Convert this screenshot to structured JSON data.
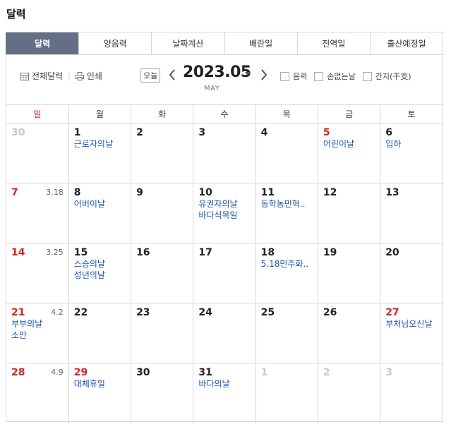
{
  "title": "달력",
  "tabs": [
    "달력",
    "양음력",
    "날짜계산",
    "배란일",
    "전역일",
    "출산예정일"
  ],
  "toolbar": {
    "full_calendar": "전체달력",
    "print": "인쇄",
    "today": "오늘",
    "year_month": "2023.05",
    "month_en": "MAY",
    "options": [
      "음력",
      "손없는날",
      "간지(干支)"
    ]
  },
  "weekdays": [
    "일",
    "월",
    "화",
    "수",
    "목",
    "금",
    "토"
  ],
  "weeks": [
    [
      {
        "d": "30",
        "type": "other",
        "lunar": "",
        "events": []
      },
      {
        "d": "1",
        "type": "normal",
        "lunar": "",
        "events": [
          "근로자의날"
        ]
      },
      {
        "d": "2",
        "type": "normal",
        "lunar": "",
        "events": []
      },
      {
        "d": "3",
        "type": "normal",
        "lunar": "",
        "events": []
      },
      {
        "d": "4",
        "type": "normal",
        "lunar": "",
        "events": []
      },
      {
        "d": "5",
        "type": "red",
        "lunar": "",
        "events": [
          "어린이날"
        ]
      },
      {
        "d": "6",
        "type": "normal",
        "lunar": "",
        "events": [
          "입하"
        ]
      }
    ],
    [
      {
        "d": "7",
        "type": "red",
        "lunar": "3.18",
        "events": []
      },
      {
        "d": "8",
        "type": "normal",
        "lunar": "",
        "events": [
          "어버이날"
        ]
      },
      {
        "d": "9",
        "type": "normal",
        "lunar": "",
        "events": []
      },
      {
        "d": "10",
        "type": "normal",
        "lunar": "",
        "events": [
          "유권자의날",
          "바다식목일"
        ]
      },
      {
        "d": "11",
        "type": "normal",
        "lunar": "",
        "events": [
          "동학농민혁.."
        ]
      },
      {
        "d": "12",
        "type": "normal",
        "lunar": "",
        "events": []
      },
      {
        "d": "13",
        "type": "normal",
        "lunar": "",
        "events": []
      }
    ],
    [
      {
        "d": "14",
        "type": "red",
        "lunar": "3.25",
        "events": []
      },
      {
        "d": "15",
        "type": "normal",
        "lunar": "",
        "events": [
          "스승의날",
          "성년의날"
        ]
      },
      {
        "d": "16",
        "type": "normal",
        "lunar": "",
        "events": []
      },
      {
        "d": "17",
        "type": "normal",
        "lunar": "",
        "events": []
      },
      {
        "d": "18",
        "type": "normal",
        "lunar": "",
        "events": [
          "5.18민주화.."
        ]
      },
      {
        "d": "19",
        "type": "normal",
        "lunar": "",
        "events": []
      },
      {
        "d": "20",
        "type": "normal",
        "lunar": "",
        "events": []
      }
    ],
    [
      {
        "d": "21",
        "type": "red",
        "lunar": "4.2",
        "events": [
          "부부의날",
          "소만"
        ]
      },
      {
        "d": "22",
        "type": "normal",
        "lunar": "",
        "events": []
      },
      {
        "d": "23",
        "type": "normal",
        "lunar": "",
        "events": []
      },
      {
        "d": "24",
        "type": "normal",
        "lunar": "",
        "events": []
      },
      {
        "d": "25",
        "type": "normal",
        "lunar": "",
        "events": []
      },
      {
        "d": "26",
        "type": "normal",
        "lunar": "",
        "events": []
      },
      {
        "d": "27",
        "type": "red",
        "lunar": "",
        "events": [
          "부처님오신날"
        ]
      }
    ],
    [
      {
        "d": "28",
        "type": "red",
        "lunar": "4.9",
        "events": []
      },
      {
        "d": "29",
        "type": "red",
        "lunar": "",
        "events": [
          "대체휴일"
        ]
      },
      {
        "d": "30",
        "type": "normal",
        "lunar": "",
        "events": []
      },
      {
        "d": "31",
        "type": "normal",
        "lunar": "",
        "events": [
          "바다의날"
        ]
      },
      {
        "d": "1",
        "type": "other",
        "lunar": "",
        "events": []
      },
      {
        "d": "2",
        "type": "other",
        "lunar": "",
        "events": []
      },
      {
        "d": "3",
        "type": "other",
        "lunar": "",
        "events": []
      }
    ]
  ]
}
